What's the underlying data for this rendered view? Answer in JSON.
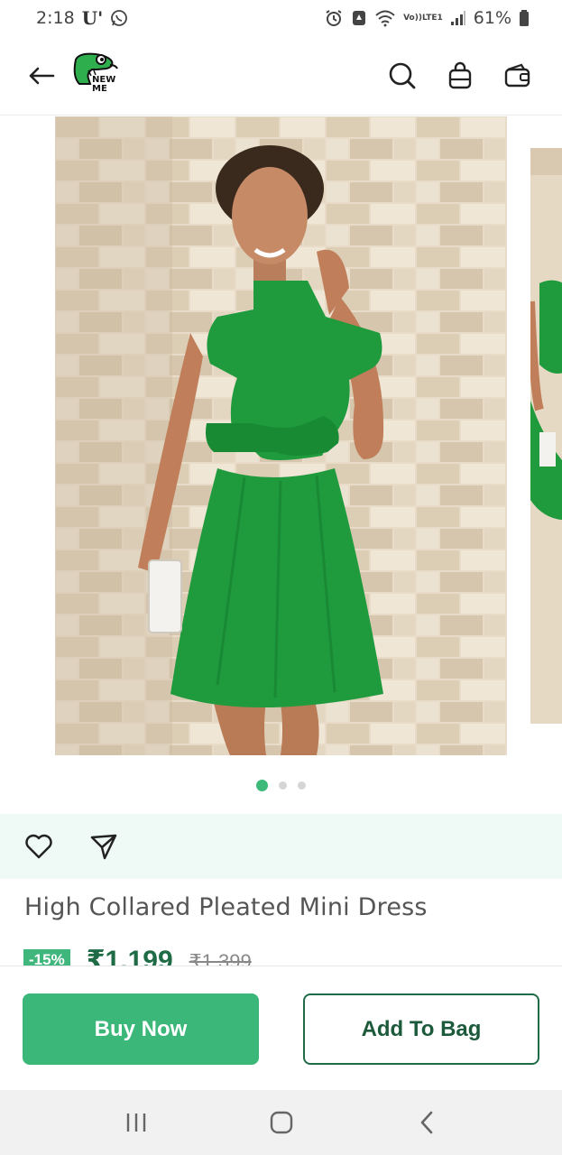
{
  "status_bar": {
    "time": "2:18",
    "left_icons": [
      "u-app-icon",
      "whatsapp-icon"
    ],
    "network_label_top": "Vo))",
    "network_label_bottom": "LTE1",
    "battery": "61%",
    "right_icons": [
      "alarm-icon",
      "notification-icon",
      "wifi-icon",
      "volte-icon",
      "signal-icon",
      "battery-icon"
    ]
  },
  "header": {
    "logo_text_line1": "NEW",
    "logo_text_line2": "ME",
    "icons": [
      "back-arrow-icon",
      "search-icon",
      "shopping-bag-icon",
      "wallet-icon"
    ]
  },
  "gallery": {
    "slide_count": 3,
    "active_slide": 1
  },
  "actions": {
    "icons": [
      "heart-icon",
      "share-icon"
    ]
  },
  "product": {
    "title": "High Collared Pleated Mini Dress",
    "discount": "-15%",
    "price": "₹1,199",
    "original_price": "₹1,399"
  },
  "buttons": {
    "buy_now": "Buy Now",
    "add_to_bag": "Add To Bag"
  },
  "nav_bar": {
    "icons": [
      "recents-icon",
      "home-icon",
      "back-icon"
    ]
  },
  "colors": {
    "brand_green": "#3bb77a",
    "dark_green": "#1f6b48",
    "action_bg": "#effaf7",
    "dress_green": "#1e9a3c"
  }
}
